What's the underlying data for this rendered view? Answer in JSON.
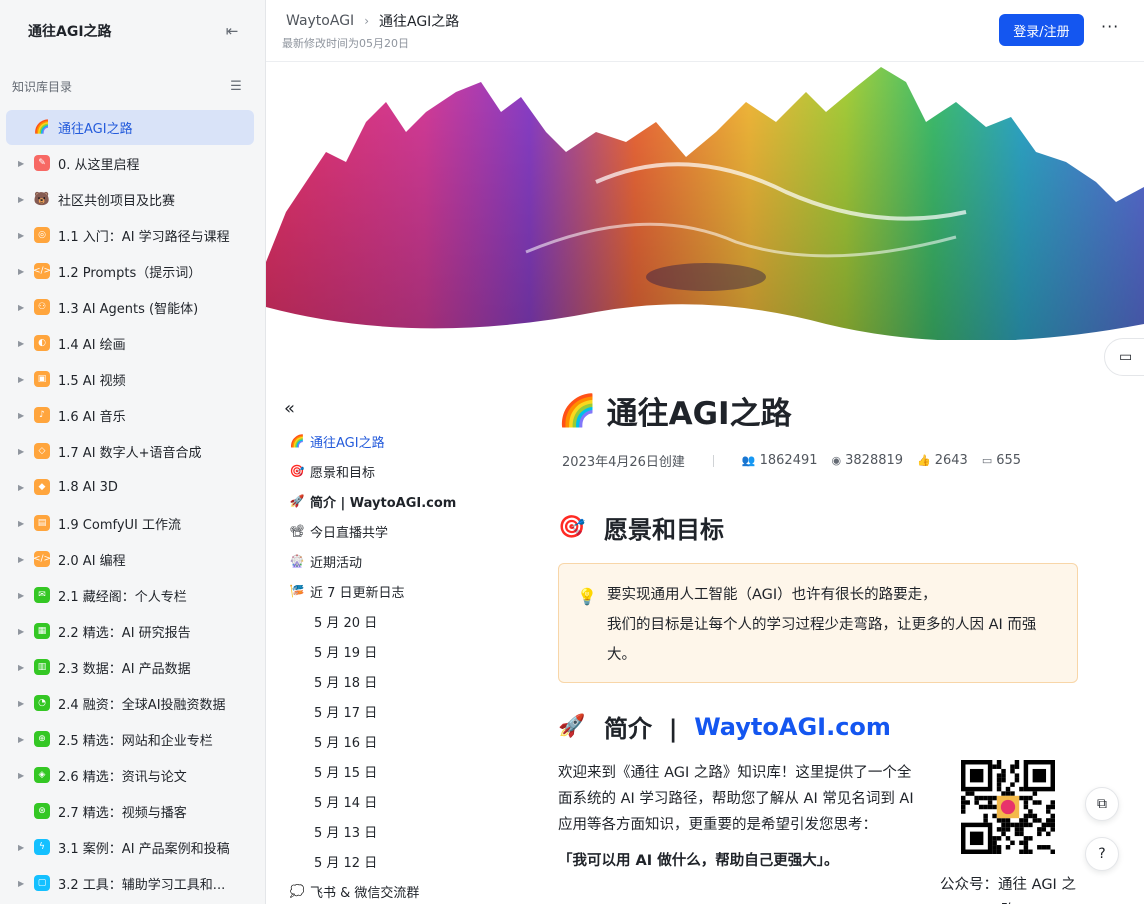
{
  "sidebar": {
    "title": "通往AGI之路",
    "section_label": "知识库目录",
    "items": [
      {
        "label": "通往AGI之路",
        "icon": "🌈",
        "color": "",
        "active": true,
        "arrow": false
      },
      {
        "label": "0. 从这里启程",
        "icon": "✎",
        "color": "#f76964",
        "arrow": true
      },
      {
        "label": "社区共创项目及比赛",
        "icon": "🐻",
        "color": "",
        "arrow": true
      },
      {
        "label": "1.1 入门：AI 学习路径与课程",
        "icon": "◎",
        "color": "#ffa53d",
        "arrow": true
      },
      {
        "label": "1.2 Prompts（提示词）",
        "icon": "</>",
        "color": "#ffa53d",
        "arrow": true
      },
      {
        "label": "1.3 AI Agents (智能体)",
        "icon": "⚇",
        "color": "#ffa53d",
        "arrow": true
      },
      {
        "label": "1.4 AI 绘画",
        "icon": "◐",
        "color": "#ffa53d",
        "arrow": true
      },
      {
        "label": "1.5 AI 视频",
        "icon": "▣",
        "color": "#ffa53d",
        "arrow": true
      },
      {
        "label": "1.6 AI 音乐",
        "icon": "♪",
        "color": "#ffa53d",
        "arrow": true
      },
      {
        "label": "1.7 AI 数字人+语音合成",
        "icon": "◇",
        "color": "#ffa53d",
        "arrow": true
      },
      {
        "label": "1.8 AI 3D",
        "icon": "◆",
        "color": "#ffa53d",
        "arrow": true
      },
      {
        "label": "1.9 ComfyUI 工作流",
        "icon": "▤",
        "color": "#ffa53d",
        "arrow": true
      },
      {
        "label": "2.0 AI 编程",
        "icon": "</>",
        "color": "#ffa53d",
        "arrow": true
      },
      {
        "label": "2.1 藏经阁：个人专栏",
        "icon": "✉",
        "color": "#34c724",
        "arrow": true
      },
      {
        "label": "2.2 精选：AI 研究报告",
        "icon": "▦",
        "color": "#34c724",
        "arrow": true
      },
      {
        "label": "2.3 数据：AI 产品数据",
        "icon": "▥",
        "color": "#34c724",
        "arrow": true
      },
      {
        "label": "2.4 融资：全球AI投融资数据",
        "icon": "◔",
        "color": "#34c724",
        "arrow": true
      },
      {
        "label": "2.5 精选：网站和企业专栏",
        "icon": "⊕",
        "color": "#34c724",
        "arrow": true
      },
      {
        "label": "2.6 精选：资讯与论文",
        "icon": "◈",
        "color": "#34c724",
        "arrow": true
      },
      {
        "label": "2.7 精选：视频与播客",
        "icon": "⊛",
        "color": "#34c724",
        "arrow": false
      },
      {
        "label": "3.1 案例：AI 产品案例和投稿",
        "icon": "ϟ",
        "color": "#14c0ff",
        "arrow": true
      },
      {
        "label": "3.2 工具：辅助学习工具和...",
        "icon": "▢",
        "color": "#14c0ff",
        "arrow": true
      }
    ]
  },
  "topbar": {
    "breadcrumb_root": "WaytoAGI",
    "breadcrumb_current": "通往AGI之路",
    "modified": "最新修改时间为05月20日",
    "login_label": "登录/注册",
    "more_label": "···"
  },
  "toc": {
    "items": [
      {
        "label": "通往AGI之路",
        "emoji": "🌈",
        "active": true,
        "sub": false
      },
      {
        "label": "愿景和目标",
        "emoji": "🎯",
        "sub": false
      },
      {
        "label": "简介 | WaytoAGI.com",
        "emoji": "🚀",
        "sub": false
      },
      {
        "label": "今日直播共学",
        "emoji": "📽",
        "sub": false
      },
      {
        "label": "近期活动",
        "emoji": "🎡",
        "sub": false
      },
      {
        "label": "近 7 日更新日志",
        "emoji": "🎏",
        "sub": false
      },
      {
        "label": "5 月 20 日",
        "sub": true
      },
      {
        "label": "5 月 19 日",
        "sub": true
      },
      {
        "label": "5 月 18 日",
        "sub": true
      },
      {
        "label": "5 月 17 日",
        "sub": true
      },
      {
        "label": "5 月 16 日",
        "sub": true
      },
      {
        "label": "5 月 15 日",
        "sub": true
      },
      {
        "label": "5 月 14 日",
        "sub": true
      },
      {
        "label": "5 月 13 日",
        "sub": true
      },
      {
        "label": "5 月 12 日",
        "sub": true
      },
      {
        "label": "飞书 & 微信交流群",
        "emoji": "💭",
        "sub": false
      }
    ]
  },
  "doc": {
    "title": "通往AGI之路",
    "title_emoji": "🌈",
    "created": "2023年4月26日创建",
    "stats": {
      "members": "1862491",
      "views": "3828819",
      "likes": "2643",
      "comments": "655"
    },
    "section1": {
      "emoji": "🎯",
      "title": "愿景和目标"
    },
    "callout_line1": "要实现通用人工智能（AGI）也许有很长的路要走，",
    "callout_line2": "我们的目标是让每个人的学习过程少走弯路，让更多的人因 AI 而强大。",
    "section2": {
      "emoji": "🚀",
      "title_prefix": "简介  |  ",
      "title_link": "WaytoAGI.com"
    },
    "intro": "欢迎来到《通往 AGI 之路》知识库！这里提供了一个全面系统的 AI 学习路径，帮助您了解从 AI 常见名词到 AI 应用等各方面知识，更重要的是希望引发您思考：",
    "intro_bold": "「我可以用 AI 做什么，帮助自己更强大」。",
    "qr_caption": "公众号：通往 AGI 之路"
  }
}
